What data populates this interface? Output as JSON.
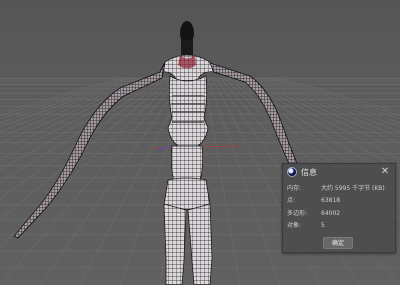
{
  "dialog": {
    "title": "信息",
    "icon": "cinema4d-logo-icon",
    "close_symbol": "✕",
    "rows": [
      {
        "label": "内存:",
        "value": "大约 5995 千字节 (KB)"
      },
      {
        "label": "点:",
        "value": "63818"
      },
      {
        "label": "多边形:",
        "value": "64002"
      },
      {
        "label": "对象:",
        "value": "5"
      }
    ],
    "ok_label": "确定"
  },
  "scene": {
    "background_color": "#5a5a5a",
    "grid_color": "#6e6e6e",
    "axis_x_color": "#b04040",
    "axis_z_color": "#4050c0",
    "mesh_color": "#1a1a1a",
    "mesh_fill_color": "#d8d0d6",
    "accent_color": "#8a2030"
  }
}
